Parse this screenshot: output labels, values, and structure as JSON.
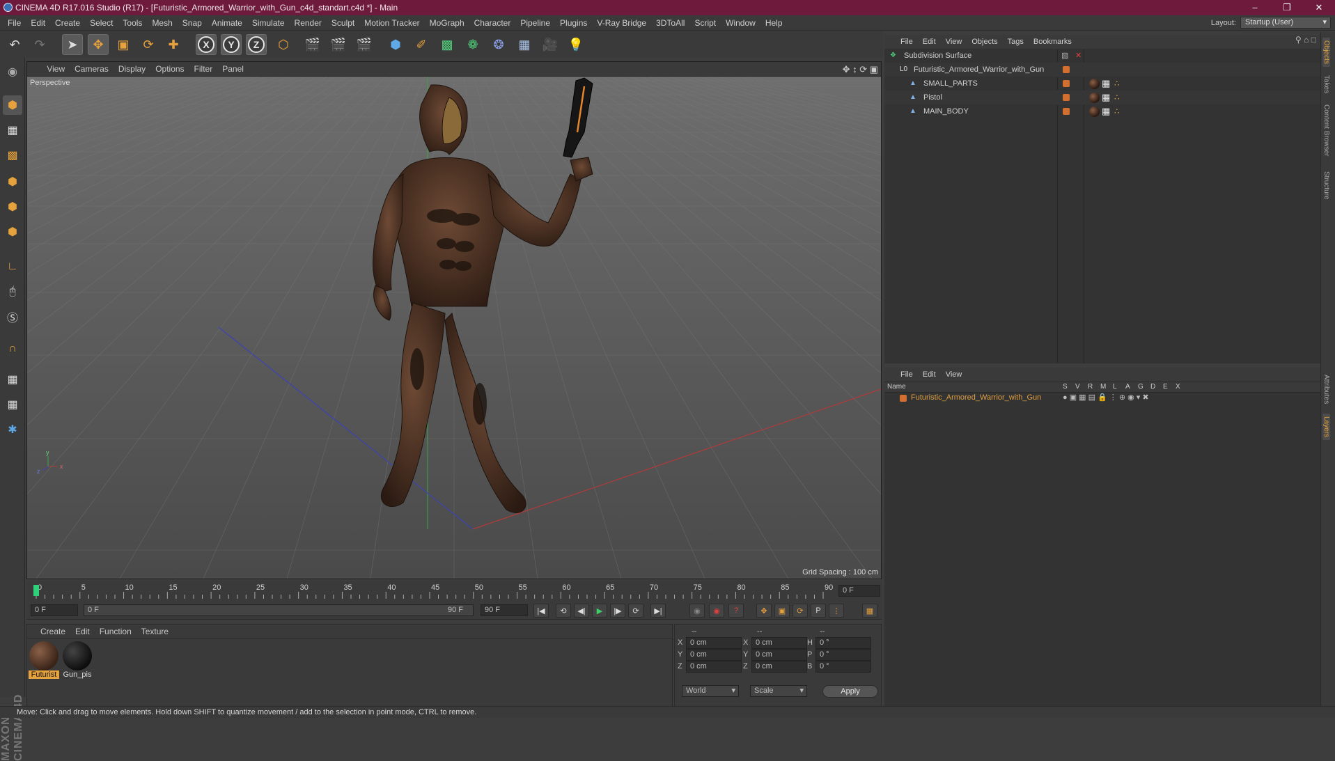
{
  "title": "CINEMA 4D R17.016 Studio (R17) - [Futuristic_Armored_Warrior_with_Gun_c4d_standart.c4d *] - Main",
  "menubar": [
    "File",
    "Edit",
    "Create",
    "Select",
    "Tools",
    "Mesh",
    "Snap",
    "Animate",
    "Simulate",
    "Render",
    "Sculpt",
    "Motion Tracker",
    "MoGraph",
    "Character",
    "Pipeline",
    "Plugins",
    "V-Ray Bridge",
    "3DToAll",
    "Script",
    "Window",
    "Help"
  ],
  "layout": {
    "label": "Layout:",
    "value": "Startup (User)"
  },
  "viewport": {
    "menu": [
      "View",
      "Cameras",
      "Display",
      "Options",
      "Filter",
      "Panel"
    ],
    "camera": "Perspective",
    "grid_spacing": "Grid Spacing : 100 cm",
    "axis_labels": {
      "y": "y",
      "x": "x",
      "z": "z"
    }
  },
  "timeline": {
    "ticks": [
      "0",
      "5",
      "10",
      "15",
      "20",
      "25",
      "30",
      "35",
      "40",
      "45",
      "50",
      "55",
      "60",
      "65",
      "70",
      "75",
      "80",
      "85",
      "90"
    ],
    "current_frame": "0 F",
    "start_frame": "0 F",
    "range_start": "0 F",
    "range_end": "90 F",
    "end_frame": "90 F"
  },
  "materials": {
    "menu": [
      "Create",
      "Edit",
      "Function",
      "Texture"
    ],
    "items": [
      {
        "label": "Futurist",
        "selected": true
      },
      {
        "label": "Gun_pis",
        "selected": false
      }
    ]
  },
  "coords": {
    "headers": [
      "--",
      "--",
      "--"
    ],
    "rows": [
      {
        "a": "X",
        "av": "0 cm",
        "b": "X",
        "bv": "0 cm",
        "c": "H",
        "cv": "0 °"
      },
      {
        "a": "Y",
        "av": "0 cm",
        "b": "Y",
        "bv": "0 cm",
        "c": "P",
        "cv": "0 °"
      },
      {
        "a": "Z",
        "av": "0 cm",
        "b": "Z",
        "bv": "0 cm",
        "c": "B",
        "cv": "0 °"
      }
    ],
    "world": "World",
    "scale": "Scale",
    "apply": "Apply"
  },
  "objects": {
    "menu": [
      "File",
      "Edit",
      "View",
      "Objects",
      "Tags",
      "Bookmarks"
    ],
    "rows": [
      {
        "name": "Subdivision Surface",
        "indent": 0
      },
      {
        "name": "Futuristic_Armored_Warrior_with_Gun",
        "indent": 1
      },
      {
        "name": "SMALL_PARTS",
        "indent": 2
      },
      {
        "name": "Pistol",
        "indent": 2
      },
      {
        "name": "MAIN_BODY",
        "indent": 2
      }
    ]
  },
  "layers": {
    "menu": [
      "File",
      "Edit",
      "View"
    ],
    "columns": [
      "Name",
      "S",
      "V",
      "R",
      "M",
      "L",
      "A",
      "G",
      "D",
      "E",
      "X"
    ],
    "rows": [
      {
        "name": "Futuristic_Armored_Warrior_with_Gun"
      }
    ]
  },
  "right_tabs": [
    "Objects",
    "Takes",
    "Content Browser",
    "Structure",
    "Attributes",
    "Layers"
  ],
  "status": "Move: Click and drag to move elements. Hold down SHIFT to quantize movement / add to the selection in point mode, CTRL to remove.",
  "brand": "MAXON CINEMA 4D",
  "colors": {
    "title_bar": "#6e1a3c",
    "accent": "#e6a23c",
    "layer_orange": "#d36f2f",
    "layer_text": "#e0a040"
  }
}
